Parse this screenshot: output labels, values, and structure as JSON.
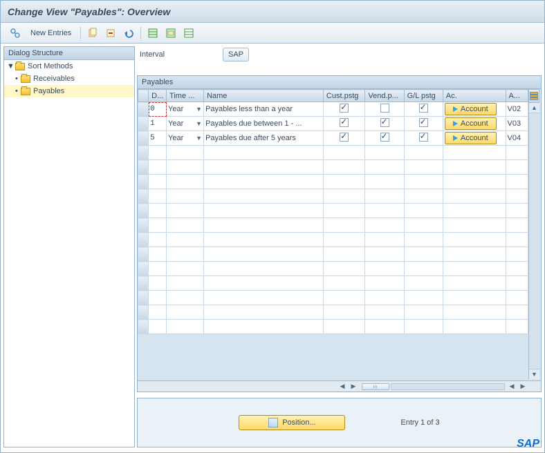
{
  "title": "Change View \"Payables\": Overview",
  "toolbar": {
    "execute": "execute-icon",
    "newEntries": "New Entries",
    "copy": "copy-icon",
    "delete": "delete-icon",
    "undo": "undo-icon",
    "selectAll": "select-all-icon",
    "selectBlock": "select-block-icon",
    "deselect": "deselect-icon"
  },
  "tree": {
    "header": "Dialog Structure",
    "root": "Sort Methods",
    "children": [
      {
        "label": "Receivables",
        "selected": false
      },
      {
        "label": "Payables",
        "selected": true
      }
    ]
  },
  "intervalLabel": "Interval",
  "intervalValue": "SAP",
  "table": {
    "title": "Payables",
    "columns": {
      "d": "D...",
      "time": "Time ...",
      "name": "Name",
      "cust": "Cust.pstg",
      "vend": "Vend.p...",
      "gl": "G/L pstg",
      "ac": "Ac.",
      "a": "A..."
    },
    "rows": [
      {
        "d": "0",
        "time": "Year",
        "name": "Payables less than a year",
        "cust": true,
        "vend": false,
        "gl": true,
        "acButton": "Account",
        "a": "V02"
      },
      {
        "d": "1",
        "time": "Year",
        "name": "Payables due between 1 - ...",
        "cust": true,
        "vend": true,
        "gl": true,
        "acButton": "Account",
        "a": "V03"
      },
      {
        "d": "5",
        "time": "Year",
        "name": "Payables due after 5 years",
        "cust": true,
        "vend": true,
        "gl": true,
        "acButton": "Account",
        "a": "V04"
      }
    ]
  },
  "positionBtn": "Position...",
  "entryText": "Entry 1 of 3",
  "logo": "SAP"
}
